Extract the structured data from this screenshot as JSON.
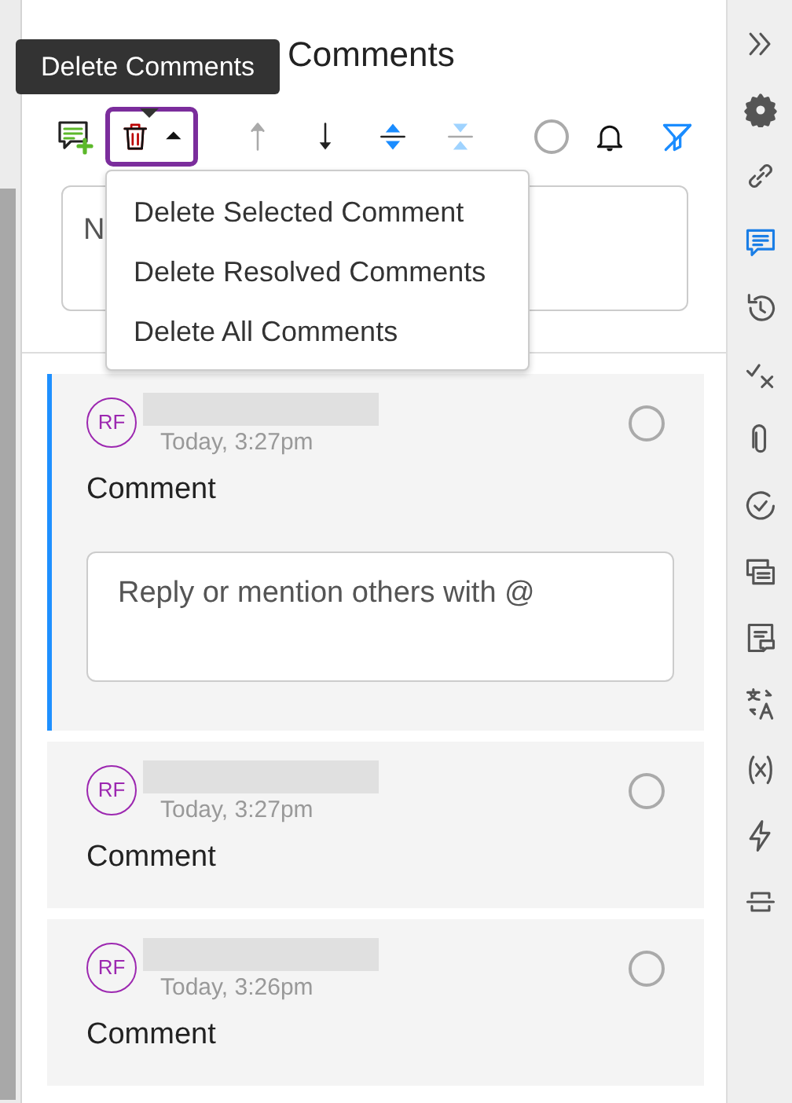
{
  "header": {
    "title": "Comments"
  },
  "tooltip": {
    "text": "Delete Comments"
  },
  "toolbar": {
    "delete_button": {
      "expanded": true
    },
    "buttons": [
      {
        "kind": "add-comment"
      },
      {
        "kind": "previous",
        "disabled": true
      },
      {
        "kind": "next",
        "disabled": false
      },
      {
        "kind": "expand-all",
        "disabled": false
      },
      {
        "kind": "collapse-all",
        "disabled": true
      },
      {
        "kind": "resolve-filter"
      },
      {
        "kind": "notifications"
      },
      {
        "kind": "filter"
      }
    ]
  },
  "search": {
    "placeholder": "N"
  },
  "menu": {
    "items": [
      {
        "label": "Delete Selected Comment"
      },
      {
        "label": "Delete Resolved Comments"
      },
      {
        "label": "Delete All Comments"
      }
    ]
  },
  "comments": [
    {
      "initials": "RF",
      "time": "Today, 3:27pm",
      "text": "Comment",
      "selected": true,
      "resolved": false,
      "reply": {
        "placeholder": "Reply or mention others with @"
      }
    },
    {
      "initials": "RF",
      "time": "Today, 3:27pm",
      "text": "Comment",
      "selected": false,
      "resolved": false
    },
    {
      "initials": "RF",
      "time": "Today, 3:26pm",
      "text": "Comment",
      "selected": false,
      "resolved": false
    }
  ],
  "sidebar": {
    "items": [
      {
        "kind": "collapse",
        "selected": false
      },
      {
        "kind": "settings",
        "selected": false
      },
      {
        "kind": "link",
        "selected": false
      },
      {
        "kind": "comments",
        "selected": true
      },
      {
        "kind": "history",
        "selected": false
      },
      {
        "kind": "track-changes",
        "selected": false
      },
      {
        "kind": "attachment",
        "selected": false
      },
      {
        "kind": "review",
        "selected": false
      },
      {
        "kind": "compare",
        "selected": false
      },
      {
        "kind": "notes",
        "selected": false
      },
      {
        "kind": "translate",
        "selected": false
      },
      {
        "kind": "variables",
        "selected": false
      },
      {
        "kind": "lightning",
        "selected": false
      },
      {
        "kind": "connector",
        "selected": false
      }
    ]
  }
}
